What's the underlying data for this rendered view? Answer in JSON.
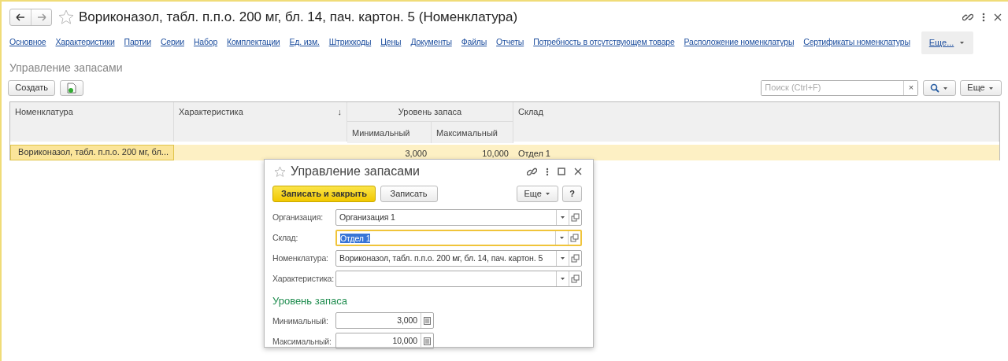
{
  "window": {
    "title": "Вориконазол, табл. п.п.о. 200 мг, бл. 14, пач. картон. 5 (Номенклатура)"
  },
  "tabs": [
    {
      "label": "Основное"
    },
    {
      "label": "Характеристики"
    },
    {
      "label": "Партии"
    },
    {
      "label": "Серии"
    },
    {
      "label": "Набор"
    },
    {
      "label": "Комплектации"
    },
    {
      "label": "Ед. изм."
    },
    {
      "label": "Штрихкоды"
    },
    {
      "label": "Цены"
    },
    {
      "label": "Документы"
    },
    {
      "label": "Файлы"
    },
    {
      "label": "Отчеты"
    },
    {
      "label": "Потребность в отсутствующем товаре"
    },
    {
      "label": "Расположение номенклатуры"
    },
    {
      "label": "Сертификаты номенклатуры"
    }
  ],
  "tabs_more": "Еще...",
  "section_title": "Управление запасами",
  "toolbar": {
    "create": "Создать",
    "search": {
      "placeholder": "Поиск (Ctrl+F)"
    },
    "clear": "×",
    "more": "Еще"
  },
  "table": {
    "column_group": "Уровень запаса",
    "columns": [
      {
        "label": "Номенклатура",
        "grouped": false
      },
      {
        "label": "Характеристика",
        "sort_mark": "↓",
        "grouped": false
      },
      {
        "label": "Минимальный",
        "grouped": true
      },
      {
        "label": "Максимальный",
        "grouped": true
      },
      {
        "label": "Склад",
        "grouped": false
      }
    ],
    "rows": [
      {
        "selected": true,
        "cells": [
          "Вориконазол, табл. п.п.о. 200 мг, бл...",
          "",
          "3,000",
          "10,000",
          "Отдел 1"
        ]
      }
    ]
  },
  "dialog": {
    "title": "Управление запасами",
    "buttons": [
      {
        "kind": "primary",
        "label": "Записать и закрыть"
      },
      {
        "kind": "plain",
        "label": "Записать"
      }
    ],
    "more": "Еще",
    "help": "?",
    "fields": [
      {
        "label": "Организация:",
        "value": "Организация 1",
        "focused": false
      },
      {
        "label": "Склад:",
        "value": "Отдел 1",
        "focused": true
      },
      {
        "label": "Номенклатура:",
        "value": "Вориконазол, табл. п.п.о. 200 мг, бл. 14, пач. картон. 5",
        "focused": false
      },
      {
        "label": "Характеристика:",
        "focused": false
      }
    ],
    "group_title": "Уровень запаса",
    "numbers": [
      {
        "label": "Минимальный:",
        "value": "3,000"
      },
      {
        "label": "Максимальный:",
        "value": "10,000"
      }
    ]
  }
}
